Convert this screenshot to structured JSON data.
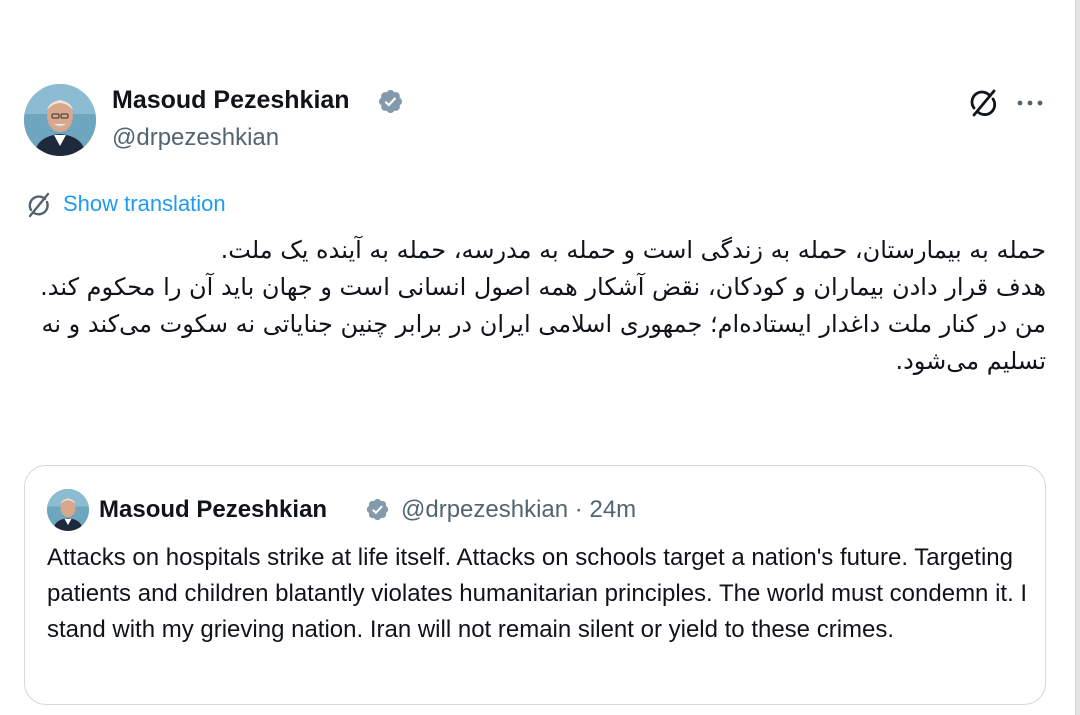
{
  "tweet": {
    "author_name": "Masoud Pezeshkian",
    "handle": "@drpezeshkian",
    "translate_label": "Show translation",
    "persian_paragraphs": [
      "حمله به بیمارستان، حمله به زندگی است و حمله به مدرسه، حمله به آینده یک ملت.",
      "هدف قرار دادن بیماران و کودکان، نقض آشکار همه اصول انسانی است و جهان باید آن را محکوم کند.",
      "من در کنار ملت داغدار ایستاده‌ام؛ جمهوری اسلامی ایران در برابر چنین جنایاتی نه سکوت می‌کند و نه تسلیم می‌شود."
    ]
  },
  "quoted_tweet": {
    "author_name": "Masoud Pezeshkian",
    "handle": "@drpezeshkian",
    "separator": "·",
    "time": "24m",
    "text": "Attacks on hospitals strike at life itself. Attacks on schools target a nation's future. Targeting patients and children blatantly violates humanitarian principles. The world must condemn it. I stand with my grieving nation. Iran will not remain silent or yield to these crimes."
  },
  "colors": {
    "link": "#1d9bf0",
    "verified_badge": "#829aab",
    "secondary_text": "#536471",
    "primary_text": "#0f1419",
    "border": "#cfd9de"
  },
  "icons": {
    "avatar": "profile-photo",
    "verified": "verified-badge-icon",
    "grok": "grok-icon",
    "more": "more-icon",
    "translate": "translate-icon"
  }
}
